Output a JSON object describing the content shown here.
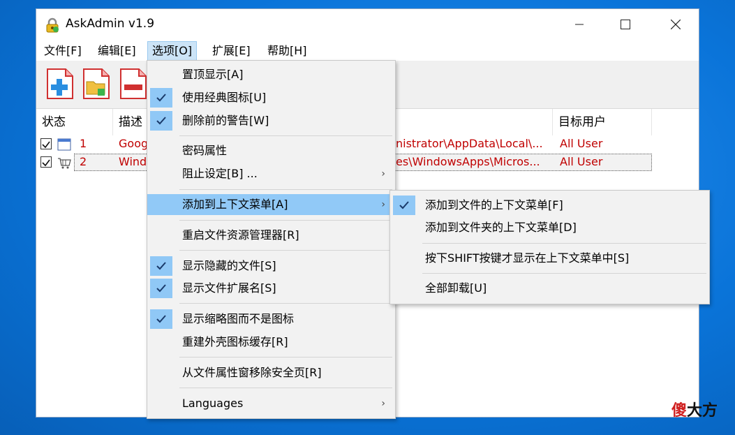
{
  "window": {
    "title": "AskAdmin v1.9"
  },
  "menubar": [
    "文件[F]",
    "编辑[E]",
    "选项[O]",
    "扩展[E]",
    "帮助[H]"
  ],
  "columns": {
    "status": "状态",
    "desc": "描述",
    "target": "目标用户"
  },
  "rows": [
    {
      "num": "1",
      "desc": "Goog",
      "path": "nistrator\\AppData\\Local\\...",
      "user": "All User"
    },
    {
      "num": "2",
      "desc": "Wind",
      "path": "es\\WindowsApps\\Micros...",
      "user": "All User"
    }
  ],
  "options_menu": {
    "top": "置顶显示[A]",
    "classic_icons": "使用经典图标[U]",
    "warn_delete": "删除前的警告[W]",
    "password": "密码属性",
    "block": "阻止设定[B] ...",
    "add_context": "添加到上下文菜单[A]",
    "restart_explorer": "重启文件资源管理器[R]",
    "show_hidden": "显示隐藏的文件[S]",
    "show_ext": "显示文件扩展名[S]",
    "show_thumbs": "显示缩略图而不是图标",
    "rebuild_icons": "重建外壳图标缓存[R]",
    "remove_security": "从文件属性窗移除安全页[R]",
    "languages": "Languages",
    "arrow": "›"
  },
  "submenu": {
    "file_context": "添加到文件的上下文菜单[F]",
    "folder_context": "添加到文件夹的上下文菜单[D]",
    "shift_only": "按下SHIFT按键才显示在上下文菜单中[S]",
    "uninstall": "全部卸载[U]"
  },
  "watermark": {
    "a": "傻",
    "b": "大方"
  },
  "colors": {
    "accent": "#0a74d9",
    "highlight": "#91c9f7",
    "red_text": "#c00000"
  }
}
